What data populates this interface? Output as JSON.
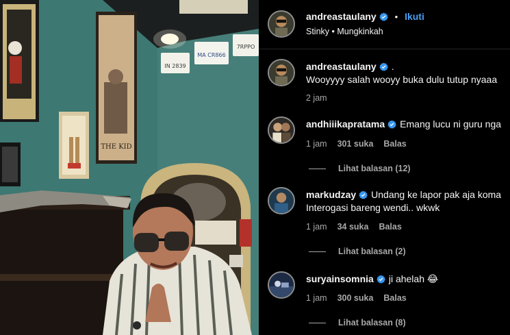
{
  "header": {
    "username": "andreastaulany",
    "separator": "•",
    "follow_label": "Ikuti",
    "audio_line": "Stinky • Mungkinkah"
  },
  "photo": {
    "plates": [
      "IN 2839",
      "MA CR866",
      "7RPPO"
    ],
    "poster_caption": "THE KID"
  },
  "comments": [
    {
      "username": "andreastaulany",
      "text": ".",
      "text_line2": "Wooyyyy salah wooyy buka dulu tutup nyaaa",
      "time": "2 jam",
      "likes": "",
      "reply_label": "",
      "view_replies": ""
    },
    {
      "username": "andhiiikapratama",
      "text": "Emang lucu ni guru nga",
      "text_line2": "",
      "time": "1 jam",
      "likes": "301 suka",
      "reply_label": "Balas",
      "view_replies": "Lihat balasan (12)"
    },
    {
      "username": "markudzay",
      "text": "Undang ke lapor pak aja koma",
      "text_line2": "Interogasi bareng wendi.. wkwk",
      "time": "1 jam",
      "likes": "34 suka",
      "reply_label": "Balas",
      "view_replies": "Lihat balasan (2)"
    },
    {
      "username": "suryainsomnia",
      "text": "ji ahelah 😂",
      "text_line2": "",
      "time": "1 jam",
      "likes": "300 suka",
      "reply_label": "Balas",
      "view_replies": "Lihat balasan (8)"
    }
  ],
  "colors": {
    "background": "#000000",
    "text": "#f5f5f5",
    "secondary": "#a8a8a8",
    "link": "#4a9ef5",
    "verified": "#3897f0",
    "wall": "#3f7a74"
  }
}
